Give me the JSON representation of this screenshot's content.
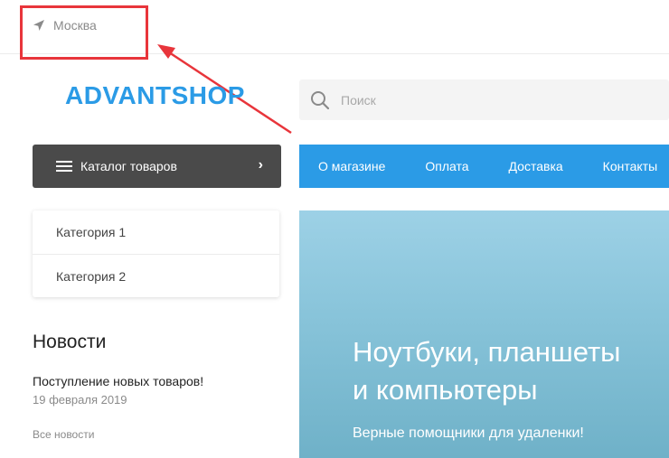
{
  "header": {
    "city": "Москва",
    "location_icon": "location-arrow-icon"
  },
  "annotation": {
    "color": "#e8353b"
  },
  "logo": {
    "text": "ADVANTSHOP",
    "color": "#2b9be6"
  },
  "search": {
    "placeholder": "Поиск",
    "value": "",
    "icon": "search-icon"
  },
  "catalog": {
    "label": "Каталог товаров",
    "icon": "hamburger-icon",
    "chevron_icon": "chevron-right-icon",
    "categories": [
      "Категория 1",
      "Категория 2"
    ]
  },
  "nav": {
    "color": "#2b9be6",
    "items": [
      "О магазине",
      "Оплата",
      "Доставка",
      "Контакты"
    ]
  },
  "news": {
    "title": "Новости",
    "items": [
      {
        "title": "Поступление новых товаров!",
        "date": "19 февраля 2019"
      }
    ],
    "all_link": "Все новости"
  },
  "banner": {
    "title_line1": "Ноутбуки, планшеты",
    "title_line2": "и компьютеры",
    "subtitle": "Верные помощники для удаленки!"
  }
}
